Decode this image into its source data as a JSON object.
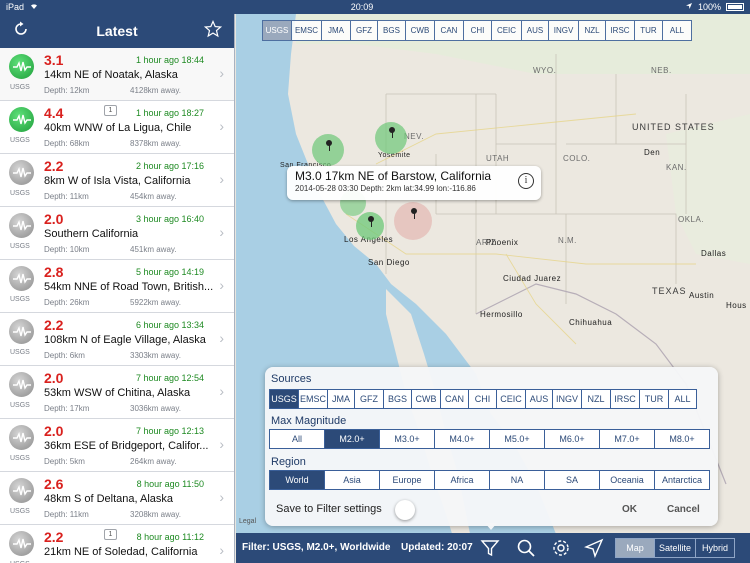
{
  "status": {
    "device": "iPad",
    "time": "20:09",
    "battery": "100%"
  },
  "sidebar": {
    "title": "Latest",
    "quakes": [
      {
        "mag": "3.1",
        "time": "1 hour ago 18:44",
        "place": "14km NE of Noatak, Alaska",
        "depth": "Depth: 12km",
        "dist": "4128km away.",
        "src": "USGS",
        "color": "green",
        "count": ""
      },
      {
        "mag": "4.4",
        "time": "1 hour ago 18:27",
        "place": "40km WNW of La Ligua, Chile",
        "depth": "Depth: 68km",
        "dist": "8378km away.",
        "src": "USGS",
        "color": "green",
        "count": "1"
      },
      {
        "mag": "2.2",
        "time": "2 hour ago 17:16",
        "place": "8km W of Isla Vista, California",
        "depth": "Depth: 11km",
        "dist": "454km away.",
        "src": "USGS",
        "color": "gray",
        "count": ""
      },
      {
        "mag": "2.0",
        "time": "3 hour ago 16:40",
        "place": "Southern California",
        "depth": "Depth: 10km",
        "dist": "451km away.",
        "src": "USGS",
        "color": "gray",
        "count": ""
      },
      {
        "mag": "2.8",
        "time": "5 hour ago 14:19",
        "place": "54km NNE of Road Town, British...",
        "depth": "Depth: 26km",
        "dist": "5922km away.",
        "src": "USGS",
        "color": "gray",
        "count": ""
      },
      {
        "mag": "2.2",
        "time": "6 hour ago 13:34",
        "place": "108km N of Eagle Village, Alaska",
        "depth": "Depth: 6km",
        "dist": "3303km away.",
        "src": "USGS",
        "color": "gray",
        "count": ""
      },
      {
        "mag": "2.0",
        "time": "7 hour ago 12:54",
        "place": "53km WSW of Chitina, Alaska",
        "depth": "Depth: 17km",
        "dist": "3036km away.",
        "src": "USGS",
        "color": "gray",
        "count": ""
      },
      {
        "mag": "2.0",
        "time": "7 hour ago 12:13",
        "place": "36km ESE of Bridgeport, Califor...",
        "depth": "Depth: 5km",
        "dist": "264km away.",
        "src": "USGS",
        "color": "gray",
        "count": ""
      },
      {
        "mag": "2.6",
        "time": "8 hour ago 11:50",
        "place": "48km S of Deltana, Alaska",
        "depth": "Depth: 11km",
        "dist": "3208km away.",
        "src": "USGS",
        "color": "gray",
        "count": ""
      },
      {
        "mag": "2.2",
        "time": "8 hour ago 11:12",
        "place": "21km NE of Soledad, California",
        "depth": "",
        "dist": "",
        "src": "USGS",
        "color": "gray",
        "count": "1"
      }
    ]
  },
  "top_sources": [
    "USGS",
    "EMSC",
    "JMA",
    "GFZ",
    "BGS",
    "CWB",
    "CAN",
    "CHI",
    "CEIC",
    "AUS",
    "INGV",
    "NZL",
    "IRSC",
    "TUR",
    "ALL"
  ],
  "top_sources_active": "USGS",
  "map_labels": {
    "wyo": "WYO.",
    "nev": "NEV.",
    "utah": "UTAH",
    "colo": "COLO.",
    "kan": "KAN.",
    "okla": "OKLA.",
    "ariz": "ARIZ.",
    "nm": "N.M.",
    "texas": "TEXAS",
    "us": "UNITED STATES",
    "neb": "NEB.",
    "yosemite": "Yosemite",
    "sf": "San Francisco",
    "la": "Los Angeles",
    "sd": "San Diego",
    "phoenix": "Phoenix",
    "juarez": "Ciudad Juarez",
    "hermosillo": "Hermosillo",
    "chihuahua": "Chihuahua",
    "dallas": "Dallas",
    "austin": "Austin",
    "denver": "Den",
    "houston": "Hous"
  },
  "callout": {
    "title": "M3.0 17km NE of Barstow, California",
    "sub": "2014-05-28 03:30 Depth: 2km lat:34.99 lon:-116.86",
    "info": "i"
  },
  "legal": "Legal",
  "filter": {
    "sources_label": "Sources",
    "sources": [
      "USGS",
      "EMSC",
      "JMA",
      "GFZ",
      "BGS",
      "CWB",
      "CAN",
      "CHI",
      "CEIC",
      "AUS",
      "INGV",
      "NZL",
      "IRSC",
      "TUR",
      "ALL"
    ],
    "sources_active": "USGS",
    "mag_label": "Max Magnitude",
    "mags": [
      "All",
      "M2.0+",
      "M3.0+",
      "M4.0+",
      "M5.0+",
      "M6.0+",
      "M7.0+",
      "M8.0+"
    ],
    "mag_active": "M2.0+",
    "region_label": "Region",
    "regions": [
      "World",
      "Asia",
      "Europe",
      "Africa",
      "NA",
      "SA",
      "Oceania",
      "Antarctica"
    ],
    "region_active": "World",
    "save_label": "Save to Filter settings",
    "ok": "OK",
    "cancel": "Cancel"
  },
  "bottom": {
    "filter_text": "Filter: USGS, M2.0+, Worldwide",
    "updated_text": "Updated: 20:07",
    "map_types": [
      "Map",
      "Satellite",
      "Hybrid"
    ],
    "map_type_active": "Map"
  },
  "colors": {
    "navy": "#2c4a78",
    "mag_red": "#d9211e",
    "time_green": "#1e8a22",
    "water": "#a9cfe4",
    "land": "#e9e6df"
  }
}
